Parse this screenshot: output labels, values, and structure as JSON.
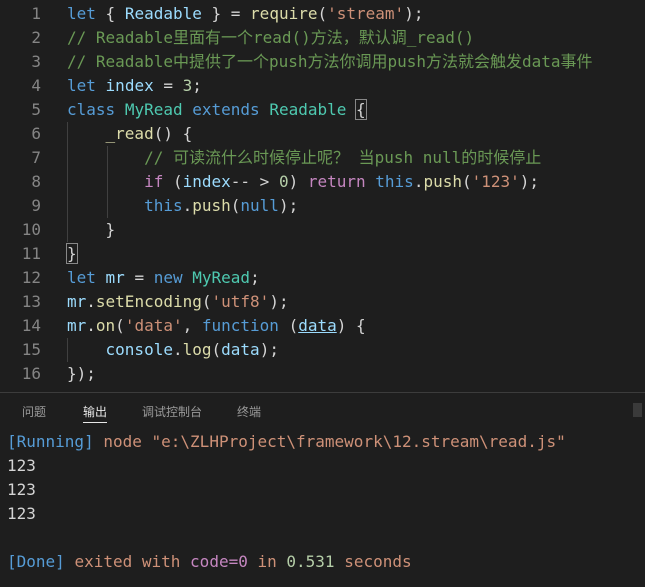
{
  "editor": {
    "lines": [
      {
        "n": "1",
        "tokens": [
          [
            "kw",
            "let"
          ],
          [
            "pl",
            " { "
          ],
          [
            "var",
            "Readable"
          ],
          [
            "pl",
            " } = "
          ],
          [
            "fn",
            "require"
          ],
          [
            "pl",
            "("
          ],
          [
            "str",
            "'stream'"
          ],
          [
            "pl",
            ");"
          ]
        ]
      },
      {
        "n": "2",
        "tokens": [
          [
            "com",
            "// Readable里面有一个read()方法，默认调_read()"
          ]
        ]
      },
      {
        "n": "3",
        "tokens": [
          [
            "com",
            "// Readable中提供了一个push方法你调用push方法就会触发data事件"
          ]
        ]
      },
      {
        "n": "4",
        "tokens": [
          [
            "kw",
            "let"
          ],
          [
            "pl",
            " "
          ],
          [
            "var",
            "index"
          ],
          [
            "pl",
            " = "
          ],
          [
            "num",
            "3"
          ],
          [
            "pl",
            ";"
          ]
        ]
      },
      {
        "n": "5",
        "tokens": [
          [
            "kw",
            "class"
          ],
          [
            "pl",
            " "
          ],
          [
            "cls",
            "MyRead"
          ],
          [
            "pl",
            " "
          ],
          [
            "kw",
            "extends"
          ],
          [
            "pl",
            " "
          ],
          [
            "cls",
            "Readable"
          ],
          [
            "pl",
            " "
          ],
          [
            "br",
            "{"
          ]
        ]
      },
      {
        "n": "6",
        "tokens": [
          [
            "pl",
            "    "
          ],
          [
            "fn",
            "_read"
          ],
          [
            "pl",
            "() {"
          ]
        ]
      },
      {
        "n": "7",
        "tokens": [
          [
            "pl",
            "        "
          ],
          [
            "com",
            "// 可读流什么时候停止呢？ 当push null的时候停止"
          ]
        ]
      },
      {
        "n": "8",
        "tokens": [
          [
            "pl",
            "        "
          ],
          [
            "ctl",
            "if"
          ],
          [
            "pl",
            " ("
          ],
          [
            "var",
            "index"
          ],
          [
            "pl",
            "-- > "
          ],
          [
            "num",
            "0"
          ],
          [
            "pl",
            ") "
          ],
          [
            "ctl",
            "return"
          ],
          [
            "pl",
            " "
          ],
          [
            "kw",
            "this"
          ],
          [
            "pl",
            "."
          ],
          [
            "fn",
            "push"
          ],
          [
            "pl",
            "("
          ],
          [
            "str",
            "'123'"
          ],
          [
            "pl",
            ");"
          ]
        ]
      },
      {
        "n": "9",
        "tokens": [
          [
            "pl",
            "        "
          ],
          [
            "kw",
            "this"
          ],
          [
            "pl",
            "."
          ],
          [
            "fn",
            "push"
          ],
          [
            "pl",
            "("
          ],
          [
            "kw",
            "null"
          ],
          [
            "pl",
            ");"
          ]
        ]
      },
      {
        "n": "10",
        "tokens": [
          [
            "pl",
            "    }"
          ]
        ]
      },
      {
        "n": "11",
        "tokens": [
          [
            "br",
            "}"
          ]
        ]
      },
      {
        "n": "12",
        "tokens": [
          [
            "kw",
            "let"
          ],
          [
            "pl",
            " "
          ],
          [
            "var",
            "mr"
          ],
          [
            "pl",
            " = "
          ],
          [
            "kw",
            "new"
          ],
          [
            "pl",
            " "
          ],
          [
            "cls",
            "MyRead"
          ],
          [
            "pl",
            ";"
          ]
        ]
      },
      {
        "n": "13",
        "tokens": [
          [
            "var",
            "mr"
          ],
          [
            "pl",
            "."
          ],
          [
            "fn",
            "setEncoding"
          ],
          [
            "pl",
            "("
          ],
          [
            "str",
            "'utf8'"
          ],
          [
            "pl",
            ");"
          ]
        ]
      },
      {
        "n": "14",
        "tokens": [
          [
            "var",
            "mr"
          ],
          [
            "pl",
            "."
          ],
          [
            "fn",
            "on"
          ],
          [
            "pl",
            "("
          ],
          [
            "str",
            "'data'"
          ],
          [
            "pl",
            ", "
          ],
          [
            "kw",
            "function"
          ],
          [
            "pl",
            " ("
          ],
          [
            "ul",
            "data"
          ],
          [
            "pl",
            ") {"
          ]
        ]
      },
      {
        "n": "15",
        "tokens": [
          [
            "pl",
            "    "
          ],
          [
            "var",
            "console"
          ],
          [
            "pl",
            "."
          ],
          [
            "fn",
            "log"
          ],
          [
            "pl",
            "("
          ],
          [
            "var",
            "data"
          ],
          [
            "pl",
            ");"
          ]
        ]
      },
      {
        "n": "16",
        "tokens": [
          [
            "pl",
            "});"
          ]
        ]
      }
    ]
  },
  "panel": {
    "tabs": [
      {
        "id": "problems",
        "label": "问题",
        "active": false
      },
      {
        "id": "output",
        "label": "输出",
        "active": true
      },
      {
        "id": "debug-console",
        "label": "调试控制台",
        "active": false
      },
      {
        "id": "terminal",
        "label": "终端",
        "active": false
      }
    ],
    "output": {
      "running_tag": "[Running]",
      "running_cmd": "node",
      "running_path": "\"e:\\ZLHProject\\framework\\12.stream\\read.js\"",
      "results": [
        "123",
        "123",
        "123"
      ],
      "done_tag": "[Done]",
      "done_text_1": "exited with",
      "done_code_label": "code=0",
      "done_text_2": "in",
      "done_seconds": "0.531",
      "done_text_3": "seconds"
    }
  },
  "colors": {
    "background": "#1e1e1e",
    "keyword": "#569cd6",
    "string": "#ce9178",
    "comment": "#6a9955"
  }
}
